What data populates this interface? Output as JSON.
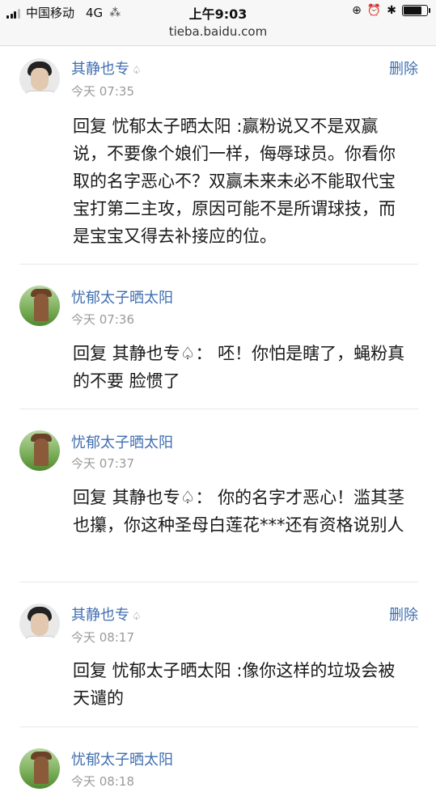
{
  "status_bar": {
    "carrier": "中国移动",
    "network": "4G",
    "loading": "⁂",
    "time": "上午9:03",
    "url": "tieba.baidu.com",
    "battery_level": 0.85
  },
  "replies": [
    {
      "username": "其静也专",
      "badge": "♤",
      "time": "今天 07:35",
      "delete_label": "删除",
      "text": "回复 忧郁太子晒太阳 :赢粉说又不是双赢说，不要像个娘们一样，侮辱球员。你看你取的名字恶心不？双赢未来未必不能取代宝宝打第二主攻，原因可能不是所谓球技，而是宝宝又得去补接应的位。"
    },
    {
      "username": "忧郁太子晒太阳",
      "time": "今天 07:36",
      "text": "回复 其静也专♤： 呸！你怕是瞎了，蝇粉真的不要 脸惯了"
    },
    {
      "username": "忧郁太子晒太阳",
      "time": "今天 07:37",
      "text": "回复 其静也专♤： 你的名字才恶心！滥其茎也攥，你这种圣母白莲花***还有资格说别人"
    },
    {
      "username": "其静也专",
      "badge": "♤",
      "time": "今天 08:17",
      "delete_label": "删除",
      "text": "回复 忧郁太子晒太阳 :像你这样的垃圾会被天谴的"
    },
    {
      "username": "忧郁太子晒太阳",
      "time": "今天 08:18"
    }
  ]
}
